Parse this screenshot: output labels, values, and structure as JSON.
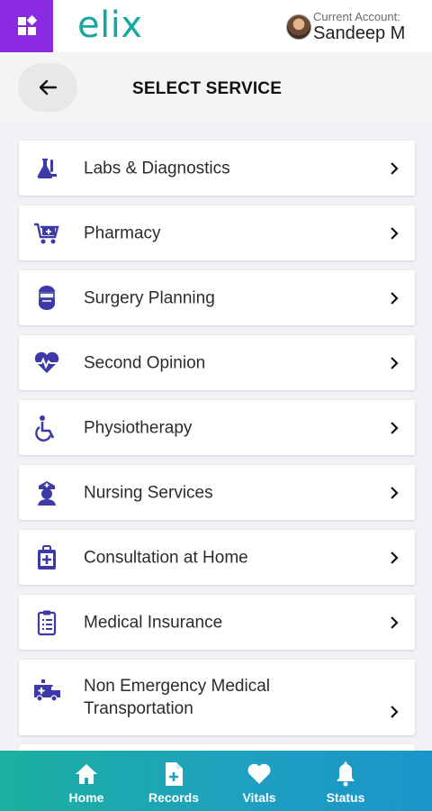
{
  "app": {
    "logo_text": "elix",
    "brand_color": "#15a7a0",
    "apps_button_color": "#8a2be2"
  },
  "account": {
    "label": "Current Account:",
    "name": "Sandeep M"
  },
  "header": {
    "title": "SELECT SERVICE",
    "back_icon": "arrow-left-icon"
  },
  "services": [
    {
      "label": "Labs & Diagnostics",
      "icon": "flask-icon"
    },
    {
      "label": "Pharmacy",
      "icon": "pharmacy-cart-icon"
    },
    {
      "label": "Surgery Planning",
      "icon": "surgeon-icon"
    },
    {
      "label": "Second Opinion",
      "icon": "heartbeat-icon"
    },
    {
      "label": "Physiotherapy",
      "icon": "wheelchair-icon"
    },
    {
      "label": "Nursing Services",
      "icon": "nurse-icon"
    },
    {
      "label": "Consultation at Home",
      "icon": "medical-bag-icon"
    },
    {
      "label": "Medical Insurance",
      "icon": "clipboard-icon"
    },
    {
      "label": "Non Emergency Medical Transportation",
      "icon": "ambulance-icon"
    }
  ],
  "icon_color": "#3d3aa8",
  "bottom_nav": [
    {
      "label": "Home",
      "icon": "home-icon"
    },
    {
      "label": "Records",
      "icon": "file-plus-icon"
    },
    {
      "label": "Vitals",
      "icon": "heart-icon"
    },
    {
      "label": "Status",
      "icon": "bell-icon"
    }
  ]
}
